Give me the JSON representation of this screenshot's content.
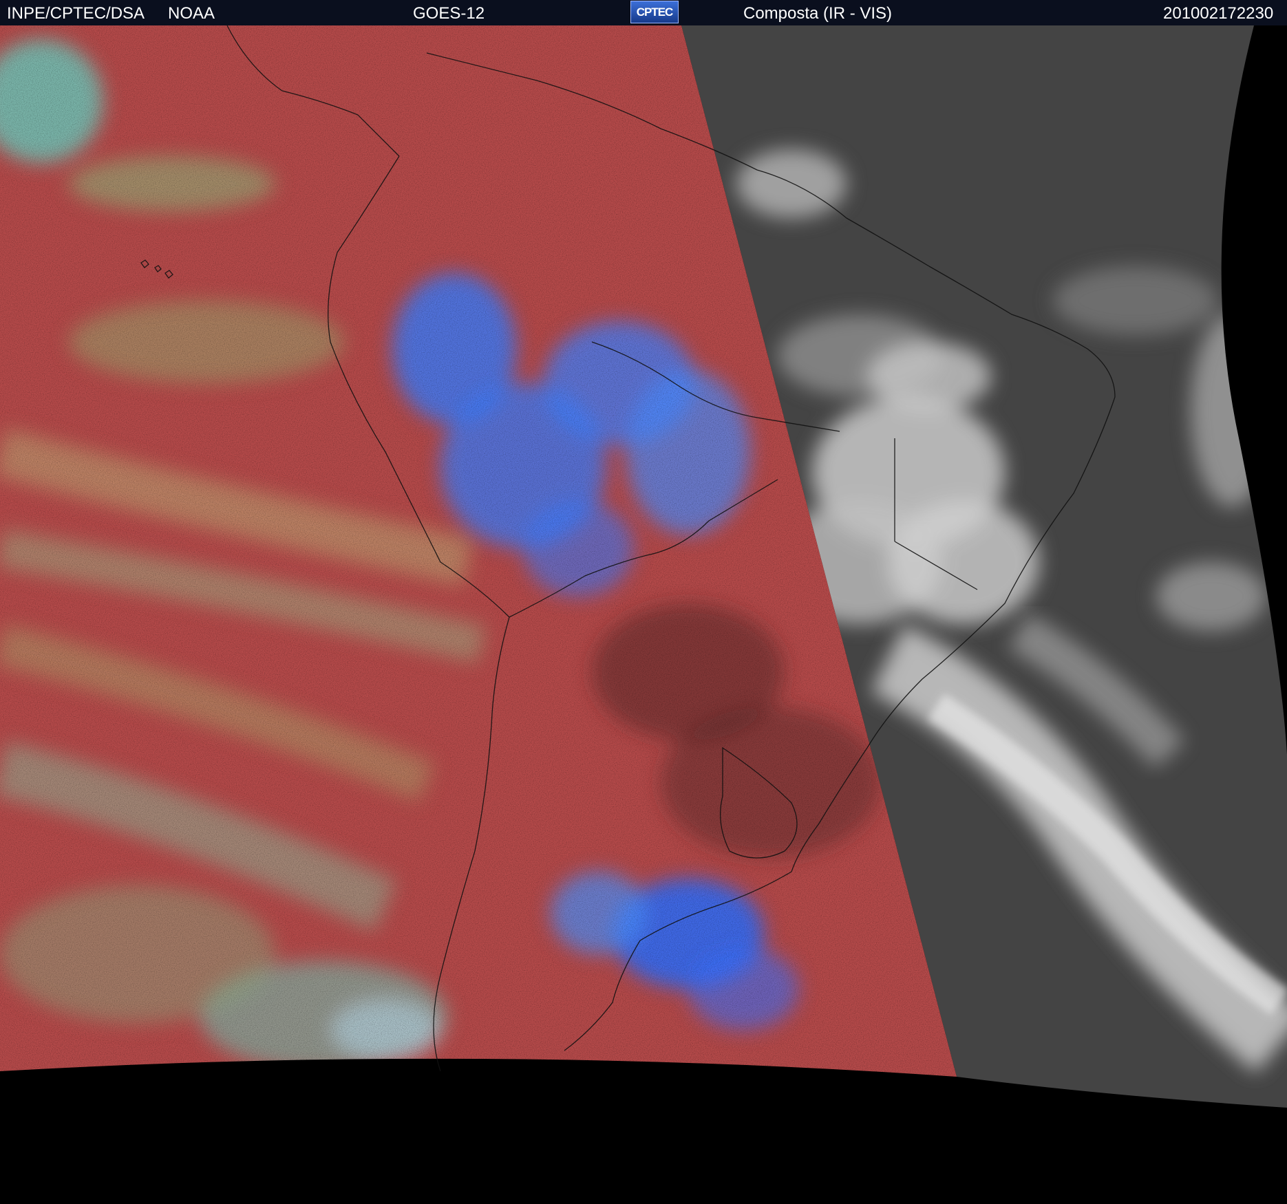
{
  "header": {
    "organization": "INPE/CPTEC/DSA",
    "agency": "NOAA",
    "satellite": "GOES-12",
    "logo_text": "CPTEC",
    "product": "Composta (IR - VIS)",
    "timestamp": "201002172230"
  },
  "colors": {
    "header_bg": "#0a0f1e",
    "ir_red": "#b54a4a",
    "ir_blue": "#3a7cff",
    "ir_cyan": "#5fe0d0",
    "ir_green": "#8fc080",
    "vis_gray": "#444444",
    "vis_cloud": "#dcdcdc",
    "space": "#000000"
  }
}
